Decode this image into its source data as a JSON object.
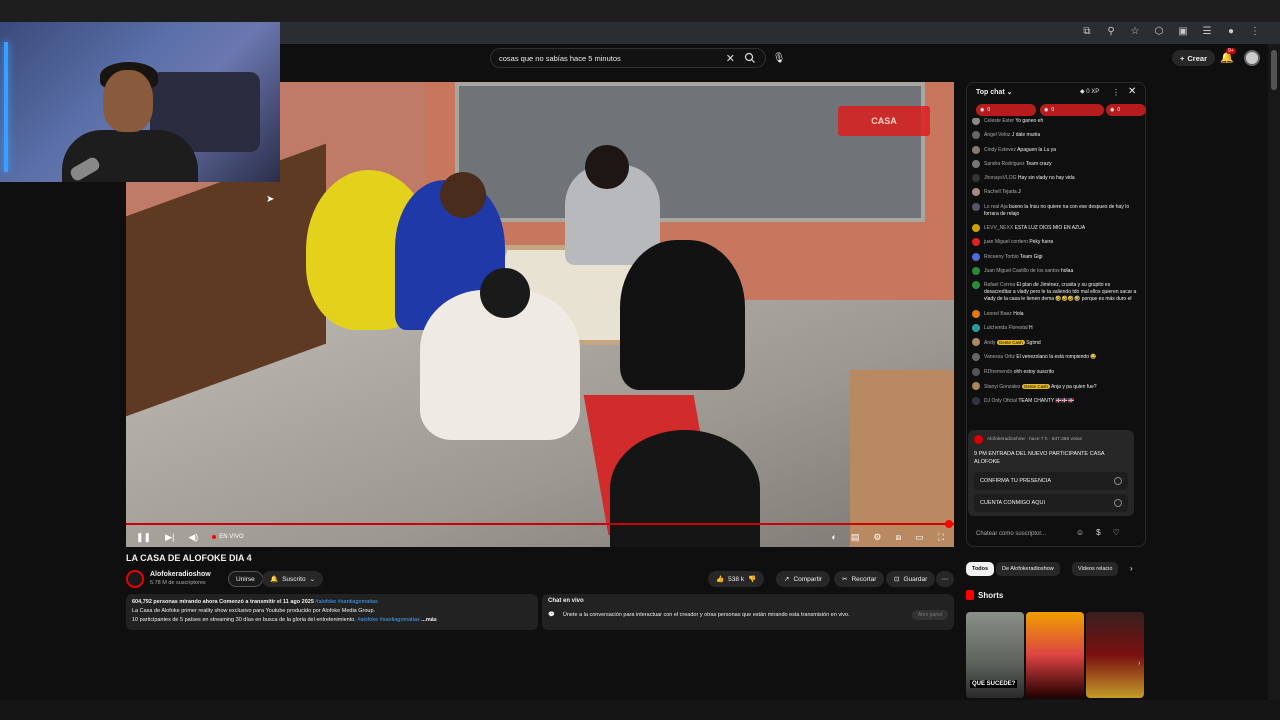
{
  "search": {
    "query": "cosas que no sabías hace 5 minutos"
  },
  "header": {
    "create_label": "Crear",
    "notif_count": "9+"
  },
  "player": {
    "live_label": "EN VIVO",
    "watermark": "CASA"
  },
  "video": {
    "title": "LA CASA DE ALOFOKE DIA 4",
    "channel": "Alofokeradioshow",
    "subscribers": "5.78 M de suscriptores",
    "join_label": "Unirse",
    "subscribed_label": "Suscrito",
    "likes": "538 k",
    "share_label": "Compartir",
    "clip_label": "Recortar",
    "save_label": "Guardar"
  },
  "description": {
    "stats": "604,792 personas mirando ahora  Comenzó a transmitir el 11 ago 2025",
    "tags1": "#alofoke #santiagomatias",
    "line2": "La Casa de Alofoke primer reality show exclusivo para Youtube producido por Alofoke Media Group.",
    "line3": "10 participantes de 5 países en streaming 30 días en busca de la gloria del entretenimiento.",
    "tags2": "#alofoke #santiagomatias",
    "more": "...más"
  },
  "chat_live": {
    "title": "Chat en vivo",
    "text": "Únete a la conversación para interactuar con el creador y otras personas que están mirando esta transmisión en vivo.",
    "button": "Abrir panel"
  },
  "chat": {
    "header": "Top chat",
    "xp": "0 XP",
    "tickers": [
      "0",
      "0",
      "0"
    ],
    "messages": [
      {
        "author": "Celeste Ester",
        "text": "Yo ganeo eh",
        "color": "#888"
      },
      {
        "author": "Angel Veloz",
        "text": "J dale muriia",
        "color": "#666"
      },
      {
        "author": "Cindy Estevez",
        "text": "Apaguen la Lu ya",
        "color": "#8a7a6a"
      },
      {
        "author": "Sandra Rodríguez",
        "text": "Team crazy",
        "color": "#777"
      },
      {
        "author": "JhonaysVLOG",
        "text": "Hay sin vlady no hay vida",
        "color": "#333"
      },
      {
        "author": "Rachell Tejada",
        "text": "J",
        "color": "#a88"
      },
      {
        "author": "Lo real Aja",
        "text": "bueno la Insu no quiere na con ese despues de hay lo forrara de relajo",
        "color": "#556"
      },
      {
        "author": "LEVV_NEXX",
        "text": "ESTA LUZ DIOS MIO EN AZUA",
        "color": "#c9a400"
      },
      {
        "author": "juan Miguel cordero",
        "text": "Peky fuera",
        "color": "#d22"
      },
      {
        "author": "Roceeny Torbio",
        "text": "Team Gigi",
        "color": "#4a6fd4"
      },
      {
        "author": "Juan Miguel Castillo de los santos",
        "text": "holaa",
        "color": "#2a8a3a"
      },
      {
        "author": "Rafael Correa",
        "text": "El plan de Jiménez, crusita y su grupito es desacreditar a vlady pero le ta saliendo tdo mal ellos quieren sacar a vlady de la casa le tienen dema 🤣🤣🤣🤣 porque es más duro el",
        "color": "#2a8a3a"
      },
      {
        "author": "Leonel Baez",
        "text": "Hola",
        "color": "#e07a10"
      },
      {
        "author": "Lulchenda Florestal",
        "text": "H",
        "color": "#2a9a9a"
      },
      {
        "author": "Andy",
        "badge": "Gente Cash",
        "text": "Sgtmd",
        "color": "#a86"
      },
      {
        "author": "Vanessa Ortiz",
        "text": "El venezolano la está rompiendo 😂",
        "color": "#666"
      },
      {
        "author": "RDtremendo",
        "text": "ohh estoy suscrito",
        "color": "#555"
      },
      {
        "author": "Stanyi Gonzalez",
        "badge": "Gente Cash",
        "text": "Anja y pa quien fue?",
        "color": "#a85"
      },
      {
        "author": "DJ Only Oficial",
        "text": "TEAM CHANTY 🇩🇴🇩🇴🇩🇴",
        "color": "#334"
      }
    ],
    "poll": {
      "meta": "Alofokeradioshow · hace 7 h · 647.356 votos",
      "question": "9 PM ENTRADA DEL NUEVO PARTICIPANTE CASA ALOFOKE",
      "option1": "CONFIRMA TU PRESENCIA",
      "option2": "CUENTA CONMIGO AQUI"
    },
    "input_placeholder": "Chatear como suscriptor..."
  },
  "recs": {
    "chips": [
      "Todos",
      "De Alofokeradioshow",
      "Videos relacio"
    ],
    "shorts_title": "Shorts",
    "short1_caption": "QUE SUCEDE?"
  }
}
